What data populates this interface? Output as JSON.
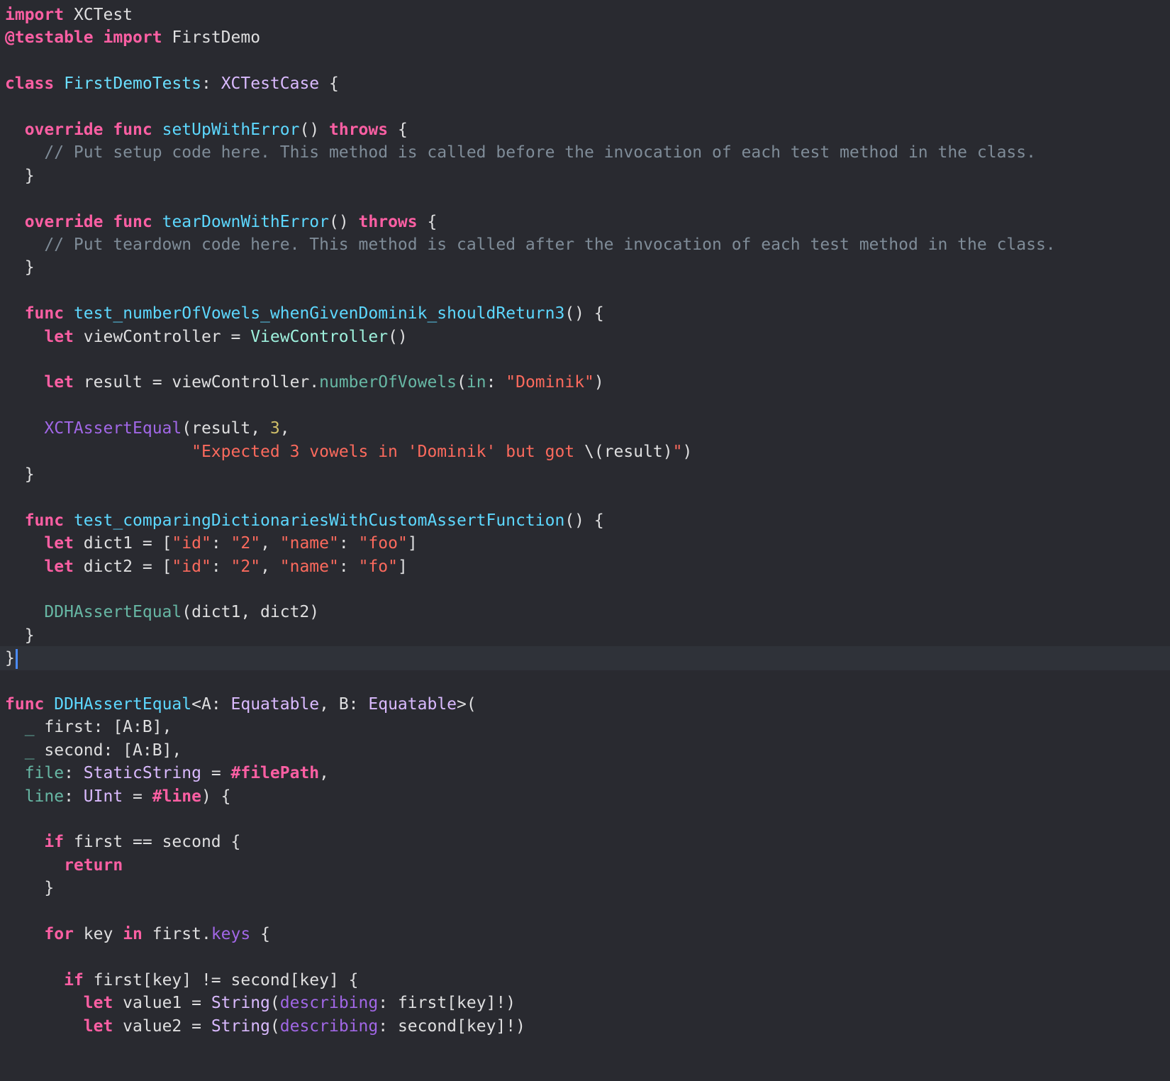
{
  "editor": {
    "background": "#292a30",
    "current_line_highlight": "#2f3239",
    "caret_color": "#4b8cff",
    "current_line_index": 28,
    "lines": [
      [
        {
          "t": "import",
          "c": "kw"
        },
        {
          "t": " XCTest"
        }
      ],
      [
        {
          "t": "@testable",
          "c": "kw"
        },
        {
          "t": " "
        },
        {
          "t": "import",
          "c": "kw"
        },
        {
          "t": " FirstDemo"
        }
      ],
      [],
      [
        {
          "t": "class",
          "c": "kw"
        },
        {
          "t": " "
        },
        {
          "t": "FirstDemoTests",
          "c": "tyd"
        },
        {
          "t": ": "
        },
        {
          "t": "XCTestCase",
          "c": "ty"
        },
        {
          "t": " {"
        }
      ],
      [],
      [
        {
          "t": "  "
        },
        {
          "t": "override",
          "c": "kw"
        },
        {
          "t": " "
        },
        {
          "t": "func",
          "c": "kw"
        },
        {
          "t": " "
        },
        {
          "t": "setUpWithError",
          "c": "fnd"
        },
        {
          "t": "() "
        },
        {
          "t": "throws",
          "c": "kw"
        },
        {
          "t": " {"
        }
      ],
      [
        {
          "t": "    "
        },
        {
          "t": "// Put setup code here. This method is called before the invocation of each test method in the class.",
          "c": "cm"
        }
      ],
      [
        {
          "t": "  }"
        }
      ],
      [],
      [
        {
          "t": "  "
        },
        {
          "t": "override",
          "c": "kw"
        },
        {
          "t": " "
        },
        {
          "t": "func",
          "c": "kw"
        },
        {
          "t": " "
        },
        {
          "t": "tearDownWithError",
          "c": "fnd"
        },
        {
          "t": "() "
        },
        {
          "t": "throws",
          "c": "kw"
        },
        {
          "t": " {"
        }
      ],
      [
        {
          "t": "    "
        },
        {
          "t": "// Put teardown code here. This method is called after the invocation of each test method in the class.",
          "c": "cm"
        }
      ],
      [
        {
          "t": "  }"
        }
      ],
      [],
      [
        {
          "t": "  "
        },
        {
          "t": "func",
          "c": "kw"
        },
        {
          "t": " "
        },
        {
          "t": "test_numberOfVowels_whenGivenDominik_shouldReturn3",
          "c": "fnd"
        },
        {
          "t": "() {"
        }
      ],
      [
        {
          "t": "    "
        },
        {
          "t": "let",
          "c": "kw"
        },
        {
          "t": " viewController = "
        },
        {
          "t": "ViewController",
          "c": "cls"
        },
        {
          "t": "()"
        }
      ],
      [],
      [
        {
          "t": "    "
        },
        {
          "t": "let",
          "c": "kw"
        },
        {
          "t": " result = viewController."
        },
        {
          "t": "numberOfVowels",
          "c": "fn"
        },
        {
          "t": "("
        },
        {
          "t": "in",
          "c": "lbl"
        },
        {
          "t": ": "
        },
        {
          "t": "\"Dominik\"",
          "c": "str"
        },
        {
          "t": ")"
        }
      ],
      [],
      [
        {
          "t": "    "
        },
        {
          "t": "XCTAssertEqual",
          "c": "prm"
        },
        {
          "t": "(result, "
        },
        {
          "t": "3",
          "c": "num"
        },
        {
          "t": ","
        }
      ],
      [
        {
          "t": "                   "
        },
        {
          "t": "\"Expected 3 vowels in 'Dominik' but got ",
          "c": "str"
        },
        {
          "t": "\\(result)"
        },
        {
          "t": "\"",
          "c": "str"
        },
        {
          "t": ")"
        }
      ],
      [
        {
          "t": "  }"
        }
      ],
      [],
      [
        {
          "t": "  "
        },
        {
          "t": "func",
          "c": "kw"
        },
        {
          "t": " "
        },
        {
          "t": "test_comparingDictionariesWithCustomAssertFunction",
          "c": "fnd"
        },
        {
          "t": "() {"
        }
      ],
      [
        {
          "t": "    "
        },
        {
          "t": "let",
          "c": "kw"
        },
        {
          "t": " dict1 = ["
        },
        {
          "t": "\"id\"",
          "c": "str"
        },
        {
          "t": ": "
        },
        {
          "t": "\"2\"",
          "c": "str"
        },
        {
          "t": ", "
        },
        {
          "t": "\"name\"",
          "c": "str"
        },
        {
          "t": ": "
        },
        {
          "t": "\"foo\"",
          "c": "str"
        },
        {
          "t": "]"
        }
      ],
      [
        {
          "t": "    "
        },
        {
          "t": "let",
          "c": "kw"
        },
        {
          "t": " dict2 = ["
        },
        {
          "t": "\"id\"",
          "c": "str"
        },
        {
          "t": ": "
        },
        {
          "t": "\"2\"",
          "c": "str"
        },
        {
          "t": ", "
        },
        {
          "t": "\"name\"",
          "c": "str"
        },
        {
          "t": ": "
        },
        {
          "t": "\"fo\"",
          "c": "str"
        },
        {
          "t": "]"
        }
      ],
      [],
      [
        {
          "t": "    "
        },
        {
          "t": "DDHAssertEqual",
          "c": "fn"
        },
        {
          "t": "(dict1, dict2)"
        }
      ],
      [
        {
          "t": "  }"
        }
      ],
      [
        {
          "t": "}"
        }
      ],
      [],
      [
        {
          "t": "func",
          "c": "kw"
        },
        {
          "t": " "
        },
        {
          "t": "DDHAssertEqual",
          "c": "fnd"
        },
        {
          "t": "<A: "
        },
        {
          "t": "Equatable",
          "c": "ty"
        },
        {
          "t": ", B: "
        },
        {
          "t": "Equatable",
          "c": "ty"
        },
        {
          "t": ">("
        }
      ],
      [
        {
          "t": "  "
        },
        {
          "t": "_",
          "c": "lbl"
        },
        {
          "t": " first: [A:B],"
        }
      ],
      [
        {
          "t": "  "
        },
        {
          "t": "_",
          "c": "lbl"
        },
        {
          "t": " second: [A:B],"
        }
      ],
      [
        {
          "t": "  "
        },
        {
          "t": "file",
          "c": "lbl"
        },
        {
          "t": ": "
        },
        {
          "t": "StaticString",
          "c": "ty"
        },
        {
          "t": " = "
        },
        {
          "t": "#filePath",
          "c": "kw"
        },
        {
          "t": ","
        }
      ],
      [
        {
          "t": "  "
        },
        {
          "t": "line",
          "c": "lbl"
        },
        {
          "t": ": "
        },
        {
          "t": "UInt",
          "c": "ty"
        },
        {
          "t": " = "
        },
        {
          "t": "#line",
          "c": "kw"
        },
        {
          "t": ") {"
        }
      ],
      [],
      [
        {
          "t": "    "
        },
        {
          "t": "if",
          "c": "kw"
        },
        {
          "t": " first == second {"
        }
      ],
      [
        {
          "t": "      "
        },
        {
          "t": "return",
          "c": "kw"
        }
      ],
      [
        {
          "t": "    }"
        }
      ],
      [],
      [
        {
          "t": "    "
        },
        {
          "t": "for",
          "c": "kw"
        },
        {
          "t": " key "
        },
        {
          "t": "in",
          "c": "kw"
        },
        {
          "t": " first."
        },
        {
          "t": "keys",
          "c": "prm"
        },
        {
          "t": " {"
        }
      ],
      [],
      [
        {
          "t": "      "
        },
        {
          "t": "if",
          "c": "kw"
        },
        {
          "t": " first[key] != second[key] {"
        }
      ],
      [
        {
          "t": "        "
        },
        {
          "t": "let",
          "c": "kw"
        },
        {
          "t": " value1 = "
        },
        {
          "t": "String",
          "c": "ty"
        },
        {
          "t": "("
        },
        {
          "t": "describing",
          "c": "prm"
        },
        {
          "t": ": first[key]!)"
        }
      ],
      [
        {
          "t": "        "
        },
        {
          "t": "let",
          "c": "kw"
        },
        {
          "t": " value2 = "
        },
        {
          "t": "String",
          "c": "ty"
        },
        {
          "t": "("
        },
        {
          "t": "describing",
          "c": "prm"
        },
        {
          "t": ": second[key]!)"
        }
      ]
    ]
  }
}
